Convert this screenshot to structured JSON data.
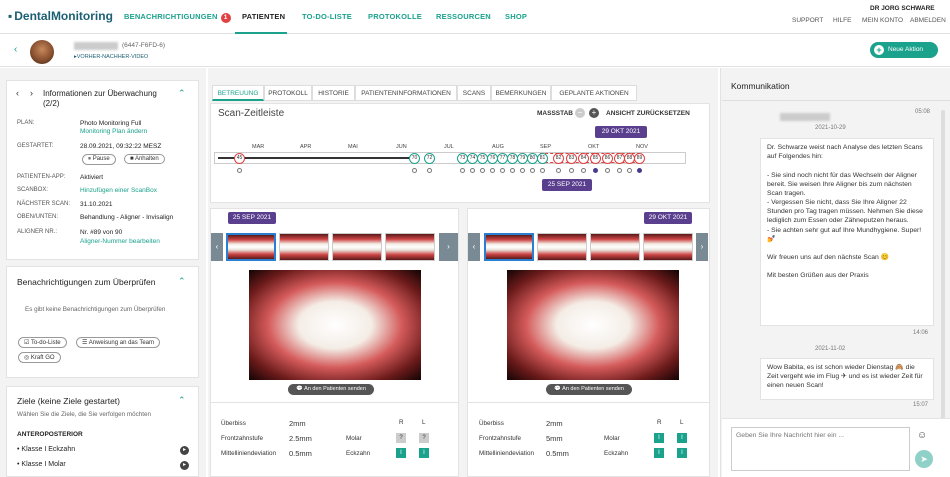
{
  "colors": {
    "accent": "#1aa28c",
    "date_badge": "#5a3f8e",
    "alert": "#e04040",
    "link": "#1aa28c"
  },
  "topbar": {
    "logo": "DentalMonitoring",
    "nav": [
      {
        "label": "BENACHRICHTIGUNGEN",
        "badge": "1"
      },
      {
        "label": "PATIENTEN"
      },
      {
        "label": "TO-DO-LISTE"
      },
      {
        "label": "PROTOKOLLE"
      },
      {
        "label": "RESSOURCEN"
      },
      {
        "label": "SHOP"
      }
    ],
    "user": "DR JORG SCHWARE",
    "links": [
      "SUPPORT",
      "HILFE",
      "MEIN KONTO",
      "ABMELDEN"
    ]
  },
  "patient": {
    "id": "(6447-F6FD-6)",
    "video_link": "VORHER-NACHHER-VIDEO",
    "new_action": "Neue Aktion"
  },
  "monitoring": {
    "title": "Informationen zur Überwachung (2/2)",
    "rows": [
      {
        "key": "PLAN:",
        "value": "Photo Monitoring Full",
        "link": "Monitoring Plan ändern"
      },
      {
        "key": "GESTARTET:",
        "value": "28.09.2021, 09:32:22 MESZ"
      },
      {
        "key": "PATIENTEN-APP:",
        "value": "Aktiviert"
      },
      {
        "key": "SCANBOX:",
        "value": "",
        "link": "Hinzufügen einer ScanBox"
      },
      {
        "key": "NÄCHSTER SCAN:",
        "value": "31.10.2021"
      },
      {
        "key": "OBEN/UNTEN:",
        "value": "Behandlung - Aligner - Invisalign"
      },
      {
        "key": "ALIGNER NR.:",
        "value": "Nr. #89 von 90",
        "link": "Aligner-Nummer bearbeiten"
      }
    ],
    "pause": "Pause",
    "stop": "Anhalten"
  },
  "notifications": {
    "title": "Benachrichtigungen zum Überprüfen",
    "empty": "Es gibt keine Benachrichtigungen zum Überprüfen",
    "buttons": [
      "To-do-Liste",
      "Anweisung an das Team",
      "Kraft GO"
    ]
  },
  "goals": {
    "title": "Ziele (keine Ziele gestartet)",
    "subtitle": "Wählen Sie die Ziele, die Sie verfolgen möchten",
    "section": "ANTEROPOSTERIOR",
    "items": [
      "Klasse I Eckzahn",
      "Klasse I Molar"
    ]
  },
  "tabs": [
    "BETREUUNG",
    "PROTOKOLL",
    "HISTORIE",
    "PATIENTENINFORMATIONEN",
    "SCANS",
    "BEMERKUNGEN",
    "GEPLANTE AKTIONEN"
  ],
  "timeline": {
    "title": "Scan-Zeitleiste",
    "scale_label": "MASSSTAB",
    "reset_label": "ANSICHT ZURÜCKSETZEN",
    "months": [
      "MAR",
      "APR",
      "MAI",
      "JUN",
      "JUL",
      "AUG",
      "SEP",
      "OKT",
      "NOV"
    ],
    "badge_top": "29 OKT 2021",
    "badge_bottom": "25 SEP 2021",
    "scans": [
      "45",
      "70",
      "72",
      "73",
      "74",
      "75",
      "76",
      "77",
      "78",
      "79",
      "80",
      "81",
      "82",
      "83",
      "84",
      "85",
      "86",
      "87",
      "88",
      "89"
    ]
  },
  "compare": {
    "left": {
      "date": "25 SEP 2021",
      "send": "An den Patienten senden",
      "ueberbiss": "2mm",
      "frontzahnstufe": "2.5mm",
      "mittellinie": "0.5mm",
      "molar_r": "?",
      "molar_l": "?",
      "eckzahn_r": "I",
      "eckzahn_l": "I"
    },
    "right": {
      "date": "29 OKT 2021",
      "send": "An den Patienten senden",
      "ueberbiss": "2mm",
      "frontzahnstufe": "5mm",
      "mittellinie": "0.5mm",
      "molar_r": "I",
      "molar_l": "I",
      "eckzahn_r": "I",
      "eckzahn_l": "I"
    },
    "labels": {
      "ueberbiss": "Überbiss",
      "frontzahnstufe": "Frontzahnstufe",
      "mittellinie": "Mittelliniendeviation",
      "molar": "Molar",
      "eckzahn": "Eckzahn",
      "r": "R",
      "l": "L"
    }
  },
  "communication": {
    "title": "Kommunikation",
    "messages": [
      {
        "time_top": "05:08",
        "date": "2021-10-29",
        "text": "Dr. Schwarze weist nach Analyse des letzten Scans auf Folgendes hin:\n\n- Sie sind noch nicht für das Wechseln der Aligner bereit. Sie weisen Ihre Aligner bis zum nächsten Scan tragen.\n- Vergessen Sie nicht, dass Sie Ihre Aligner 22 Stunden pro Tag tragen müssen. Nehmen Sie diese lediglich zum Essen oder Zähneputzen heraus.\n- Sie achten sehr gut auf Ihre Mundhygiene. Super!💅\n\nWir freuen uns auf den nächste Scan 😊\n\nMit besten Grüßen aus der Praxis",
        "time": "14:06"
      },
      {
        "date": "2021-11-02",
        "text": "Wow Babita, es ist schon wieder Dienstag 🙈 die Zeit vergeht wie im Flug ✈ und es ist wieder Zeit für einen neuen Scan!",
        "time": "15:07"
      }
    ],
    "placeholder": "Geben Sie Ihre Nachricht hier ein ..."
  }
}
